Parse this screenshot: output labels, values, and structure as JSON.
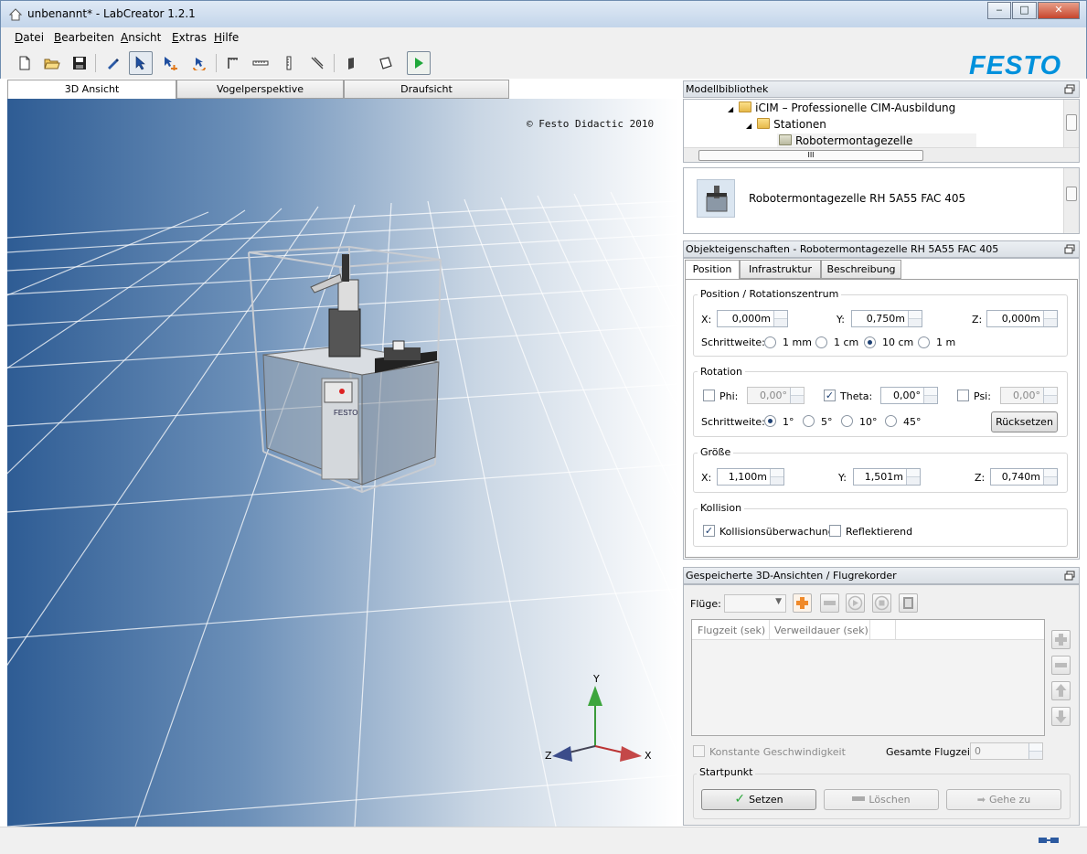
{
  "window": {
    "title": "unbenannt* - LabCreator 1.2.1",
    "minimize": "‒",
    "maximize": "□",
    "close": "✕"
  },
  "menu": [
    "Datei",
    "Bearbeiten",
    "Ansicht",
    "Extras",
    "Hilfe"
  ],
  "toolbar": {
    "icons": [
      "new-file-icon",
      "open-folder-icon",
      "save-icon",
      "pencil-tool-icon",
      "pointer-tool-icon",
      "move-tool-icon",
      "rotate-tool-icon",
      "measure-x-icon",
      "measure-ruler-icon",
      "measure-vertical-icon",
      "angle-tool-icon",
      "paint-tool-icon",
      "box-tool-icon",
      "run-icon"
    ]
  },
  "brand": {
    "logo": "FESTO",
    "color": "#0091dc"
  },
  "view_tabs": [
    "3D Ansicht",
    "Vogelperspektive",
    "Draufsicht"
  ],
  "viewport": {
    "copyright": "© Festo Didactic 2010",
    "axes": {
      "y": "Y",
      "x": "X",
      "z": "Z"
    }
  },
  "library": {
    "header": "Modellbibliothek",
    "tree": [
      "iCIM – Professionelle CIM-Ausbildung",
      "Stationen",
      "Robotermontagezelle"
    ],
    "hscroll_grip": "III",
    "preview_item": "Robotermontagezelle RH 5A55 FAC 405"
  },
  "properties": {
    "header": "Objekteigenschaften - Robotermontagezelle RH 5A55 FAC 405",
    "tabs": [
      "Position",
      "Infrastruktur",
      "Beschreibung"
    ],
    "position": {
      "group": "Position / Rotationszentrum",
      "x_label": "X:",
      "x": "0,000m",
      "y_label": "Y:",
      "y": "0,750m",
      "z_label": "Z:",
      "z": "0,000m",
      "step_label": "Schrittweite:",
      "steps": [
        "1 mm",
        "1 cm",
        "10 cm",
        "1 m"
      ],
      "step_selected": 2
    },
    "rotation": {
      "group": "Rotation",
      "phi_label": "Phi:",
      "phi": "0,00°",
      "phi_checked": false,
      "theta_label": "Theta:",
      "theta": "0,00°",
      "theta_checked": true,
      "psi_label": "Psi:",
      "psi": "0,00°",
      "psi_checked": false,
      "step_label": "Schrittweite:",
      "steps": [
        "1°",
        "5°",
        "10°",
        "45°"
      ],
      "step_selected": 0,
      "reset": "Rücksetzen"
    },
    "size": {
      "group": "Größe",
      "x_label": "X:",
      "x": "1,100m",
      "y_label": "Y:",
      "y": "1,501m",
      "z_label": "Z:",
      "z": "0,740m"
    },
    "collision": {
      "group": "Kollision",
      "monitoring": "Kollisionsüberwachung",
      "monitoring_checked": true,
      "reflecting": "Reflektierend",
      "reflecting_checked": false
    }
  },
  "recorder": {
    "header": "Gespeicherte 3D-Ansichten / Flugrekorder",
    "fluege_label": "Flüge:",
    "columns": [
      "Flugzeit (sek)",
      "Verweildauer (sek)"
    ],
    "constant_speed": "Konstante Geschwindigkeit",
    "total_label": "Gesamte Flugzeit:",
    "total_value": "0",
    "startpunkt": "Startpunkt",
    "set": "Setzen",
    "delete": "Löschen",
    "goto": "Gehe zu"
  }
}
